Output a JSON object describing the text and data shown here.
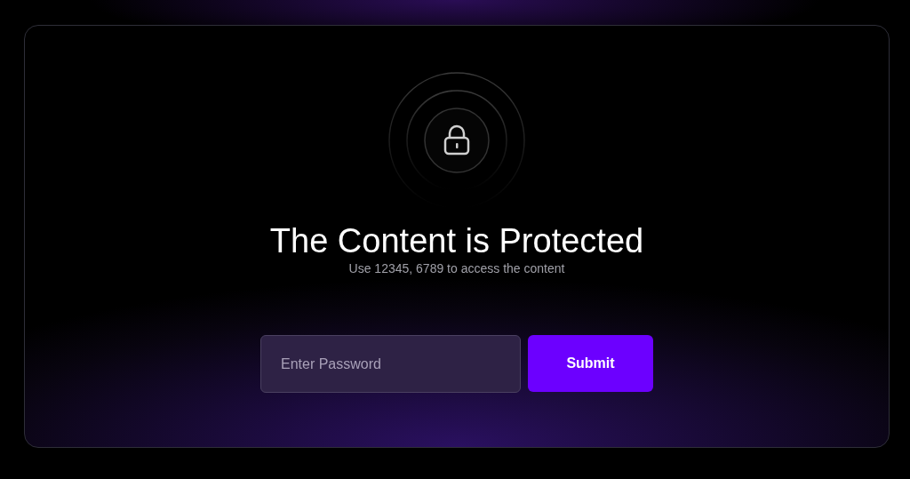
{
  "title": "The Content is Protected",
  "hint": "Use 12345, 6789 to access the content",
  "password": {
    "placeholder": "Enter Password"
  },
  "submit": {
    "label": "Submit"
  }
}
